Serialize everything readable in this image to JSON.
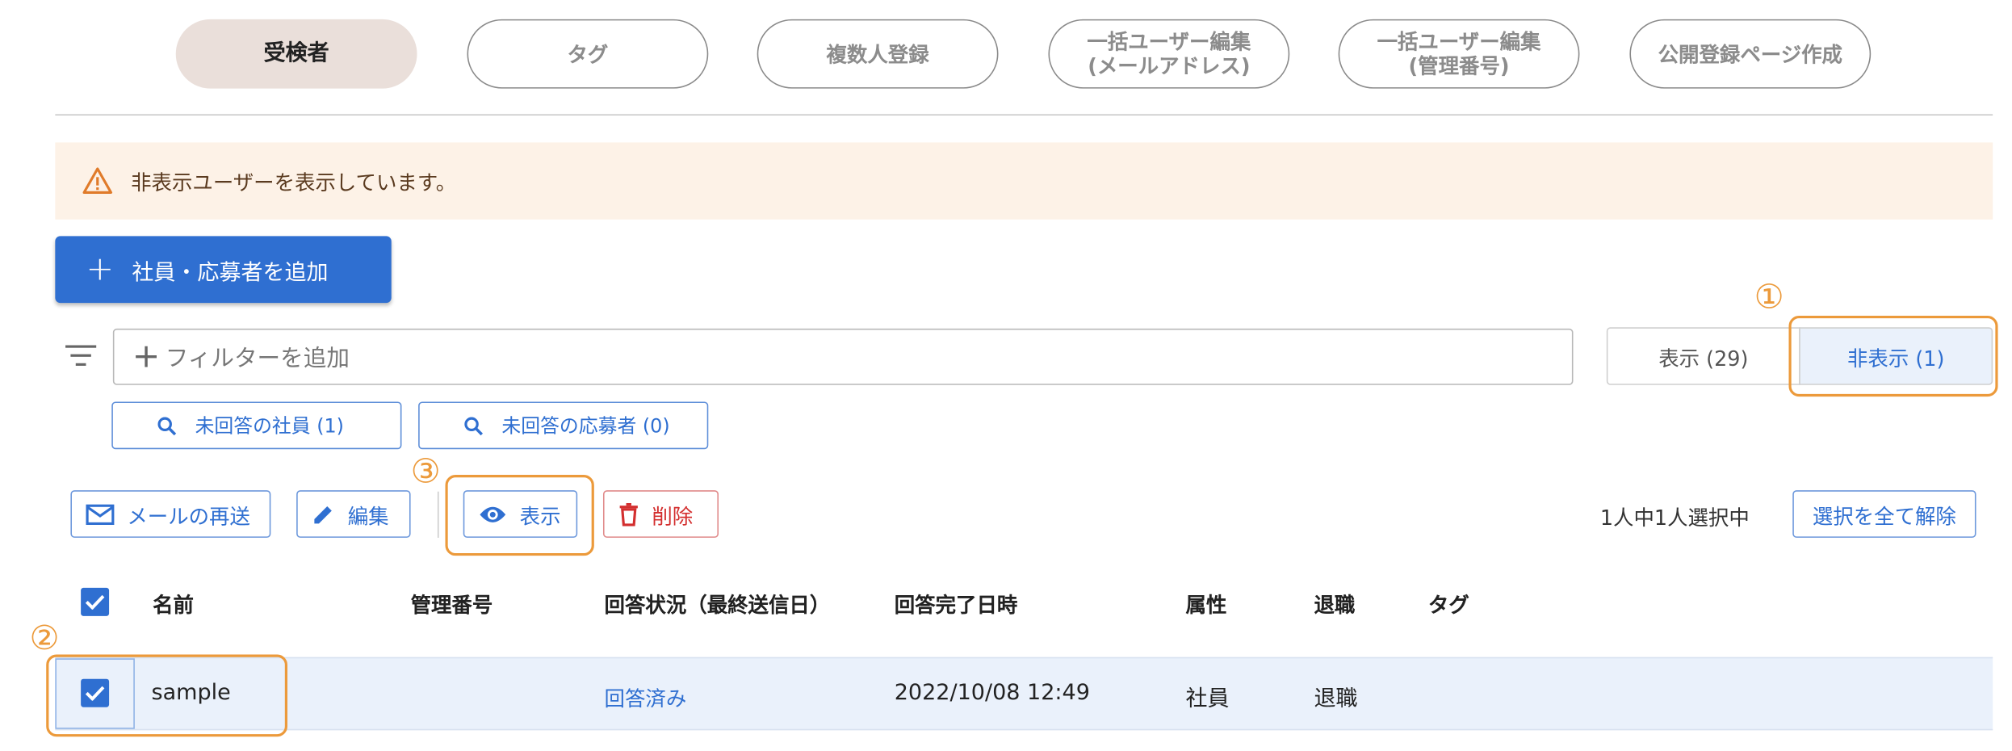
{
  "tabs": [
    {
      "label": "受検者",
      "active": true
    },
    {
      "label": "タグ",
      "active": false
    },
    {
      "label": "複数人登録",
      "active": false
    },
    {
      "label_line1": "一括ユーザー編集",
      "label_line2": "(メールアドレス)",
      "active": false
    },
    {
      "label_line1": "一括ユーザー編集",
      "label_line2": "(管理番号)",
      "active": false
    },
    {
      "label": "公開登録ページ作成",
      "active": false
    }
  ],
  "banner": {
    "message": "非表示ユーザーを表示しています。",
    "icon": "warning-icon",
    "color": "#e07b2a"
  },
  "add_button": {
    "label": "社員・応募者を追加",
    "icon": "plus-icon"
  },
  "filter": {
    "placeholder": "フィルターを追加",
    "icon": "filter-icon"
  },
  "visibility_toggle": {
    "visible": "表示 (29)",
    "hidden": "非表示 (1)",
    "selected": "hidden"
  },
  "quick_filters": [
    {
      "label": "未回答の社員 (1)",
      "icon": "search-icon"
    },
    {
      "label": "未回答の応募者 (0)",
      "icon": "search-icon"
    }
  ],
  "actions": {
    "resend": "メールの再送",
    "edit": "編集",
    "show": "表示",
    "delete": "削除"
  },
  "selection": {
    "status": "1人中1人選択中",
    "clear_label": "選択を全て解除"
  },
  "table": {
    "headers": [
      "名前",
      "管理番号",
      "回答状況（最終送信日）",
      "回答完了日時",
      "属性",
      "退職",
      "タグ"
    ],
    "rows": [
      {
        "name": "sample",
        "management_number": "",
        "status": "回答済み",
        "completed_at": "2022/10/08 12:49",
        "attribute": "社員",
        "retired": "退職",
        "tag": "",
        "checked": true
      }
    ]
  },
  "annotations": {
    "one": "①",
    "two": "②",
    "three": "③"
  },
  "colors": {
    "accent": "#2f6fd1",
    "annotation": "#ec9a3b",
    "danger": "#d32f2f",
    "banner_bg": "#fdf2e7"
  }
}
